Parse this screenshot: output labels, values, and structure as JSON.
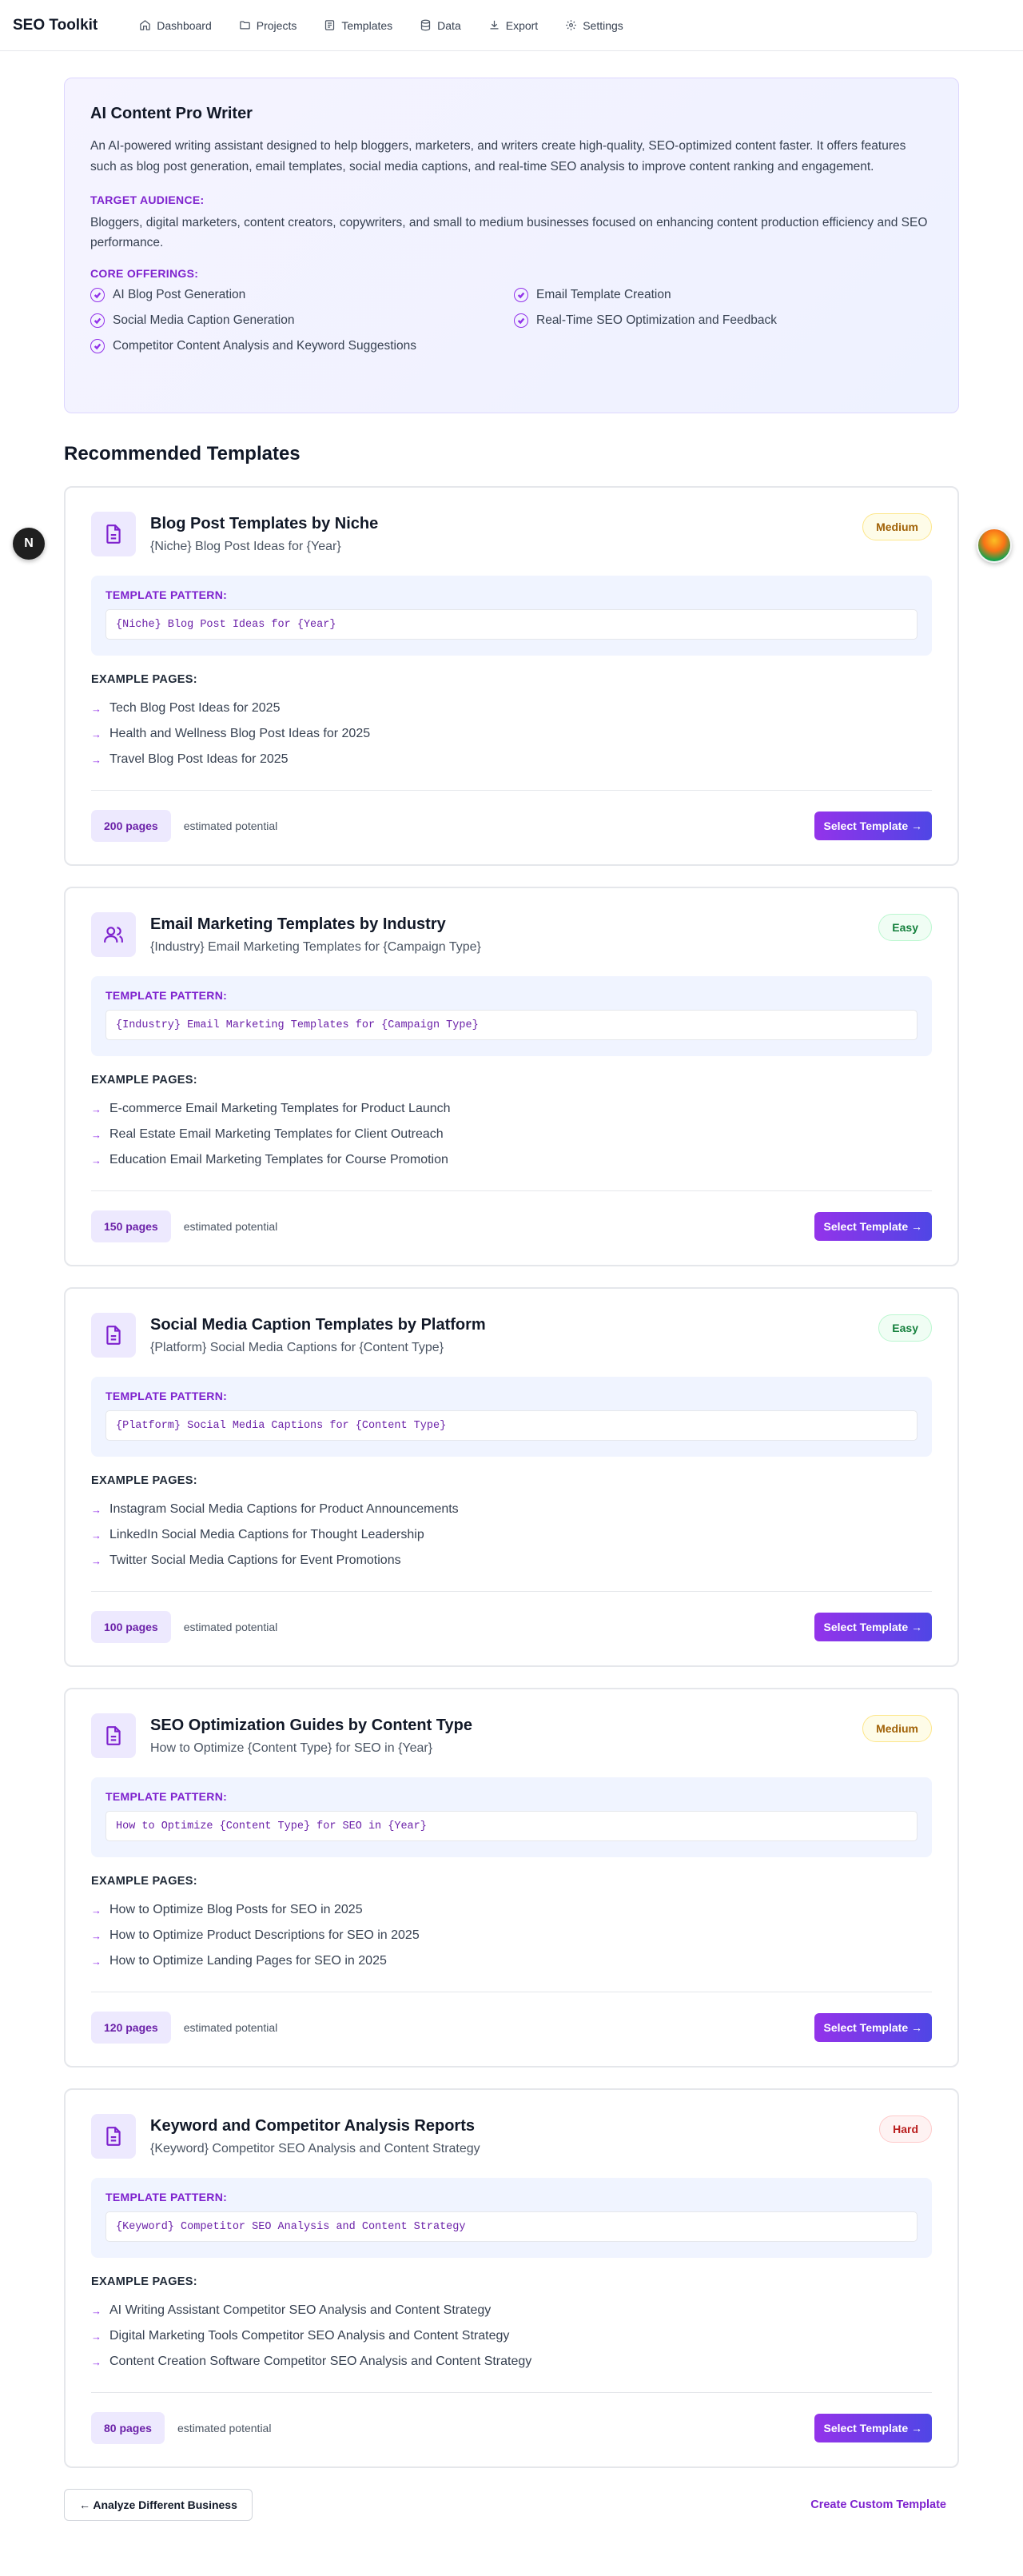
{
  "nav": {
    "brand": "SEO Toolkit",
    "items": [
      {
        "label": "Dashboard",
        "icon": "home-icon"
      },
      {
        "label": "Projects",
        "icon": "folder-icon"
      },
      {
        "label": "Templates",
        "icon": "template-icon"
      },
      {
        "label": "Data",
        "icon": "database-icon"
      },
      {
        "label": "Export",
        "icon": "download-icon"
      },
      {
        "label": "Settings",
        "icon": "gear-icon"
      }
    ]
  },
  "business": {
    "title": "AI Content Pro Writer",
    "description": "An AI-powered writing assistant designed to help bloggers, marketers, and writers create high-quality, SEO-optimized content faster. It offers features such as blog post generation, email templates, social media captions, and real-time SEO analysis to improve content ranking and engagement.",
    "audience_label": "TARGET AUDIENCE:",
    "audience": "Bloggers, digital marketers, content creators, copywriters, and small to medium businesses focused on enhancing content production efficiency and SEO performance.",
    "offerings_label": "CORE OFFERINGS:",
    "offerings": [
      "AI Blog Post Generation",
      "Email Template Creation",
      "Social Media Caption Generation",
      "Real-Time SEO Optimization and Feedback",
      "Competitor Content Analysis and Keyword Suggestions"
    ]
  },
  "section_title": "Recommended Templates",
  "labels": {
    "pattern": "TEMPLATE PATTERN:",
    "examples": "EXAMPLE PAGES:",
    "estimate": "estimated potential",
    "select": "Select Template →"
  },
  "templates": [
    {
      "name": "Blog Post Templates by Niche",
      "subtitle": "{Niche} Blog Post Ideas for {Year}",
      "difficulty": "Medium",
      "pattern": "{Niche} Blog Post Ideas for {Year}",
      "examples": [
        "Tech Blog Post Ideas for 2025",
        "Health and Wellness Blog Post Ideas for 2025",
        "Travel Blog Post Ideas for 2025"
      ],
      "pages": "200 pages",
      "icon": "document-icon"
    },
    {
      "name": "Email Marketing Templates by Industry",
      "subtitle": "{Industry} Email Marketing Templates for {Campaign Type}",
      "difficulty": "Easy",
      "pattern": "{Industry} Email Marketing Templates for {Campaign Type}",
      "examples": [
        "E-commerce Email Marketing Templates for Product Launch",
        "Real Estate Email Marketing Templates for Client Outreach",
        "Education Email Marketing Templates for Course Promotion"
      ],
      "pages": "150 pages",
      "icon": "users-icon"
    },
    {
      "name": "Social Media Caption Templates by Platform",
      "subtitle": "{Platform} Social Media Captions for {Content Type}",
      "difficulty": "Easy",
      "pattern": "{Platform} Social Media Captions for {Content Type}",
      "examples": [
        "Instagram Social Media Captions for Product Announcements",
        "LinkedIn Social Media Captions for Thought Leadership",
        "Twitter Social Media Captions for Event Promotions"
      ],
      "pages": "100 pages",
      "icon": "document-icon"
    },
    {
      "name": "SEO Optimization Guides by Content Type",
      "subtitle": "How to Optimize {Content Type} for SEO in {Year}",
      "difficulty": "Medium",
      "pattern": "How to Optimize {Content Type} for SEO in {Year}",
      "examples": [
        "How to Optimize Blog Posts for SEO in 2025",
        "How to Optimize Product Descriptions for SEO in 2025",
        "How to Optimize Landing Pages for SEO in 2025"
      ],
      "pages": "120 pages",
      "icon": "document-icon"
    },
    {
      "name": "Keyword and Competitor Analysis Reports",
      "subtitle": "{Keyword} Competitor SEO Analysis and Content Strategy",
      "difficulty": "Hard",
      "pattern": "{Keyword} Competitor SEO Analysis and Content Strategy",
      "examples": [
        "AI Writing Assistant Competitor SEO Analysis and Content Strategy",
        "Digital Marketing Tools Competitor SEO Analysis and Content Strategy",
        "Content Creation Software Competitor SEO Analysis and Content Strategy"
      ],
      "pages": "80 pages",
      "icon": "document-icon"
    }
  ],
  "bottom": {
    "back": "← Analyze Different Business",
    "custom": "Create Custom Template"
  },
  "floating": {
    "left_badge": "N"
  },
  "colors": {
    "accent": "#9333ea",
    "accent_dark": "#7e22ce",
    "gradient_end": "#4f46e5"
  }
}
